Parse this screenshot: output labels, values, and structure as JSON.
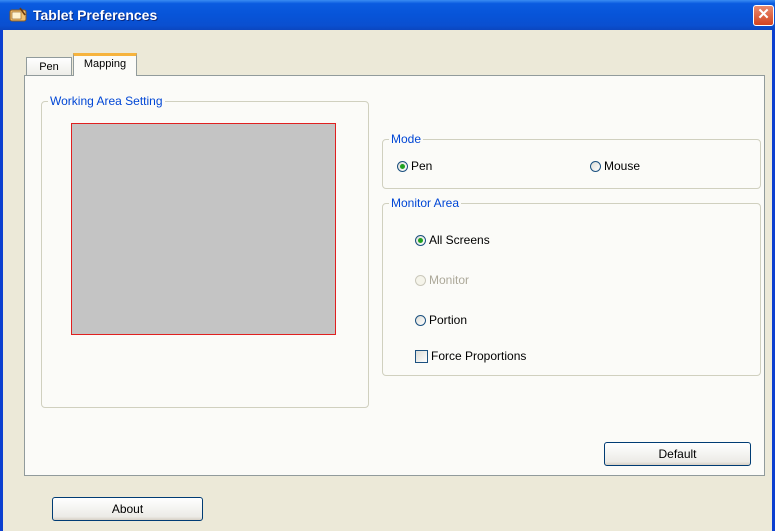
{
  "window": {
    "title": "Tablet Preferences",
    "close_glyph": "✕"
  },
  "tabs": [
    {
      "label": "Pen"
    },
    {
      "label": "Mapping"
    }
  ],
  "working_area": {
    "label": "Working Area Setting"
  },
  "mode": {
    "label": "Mode",
    "options": [
      {
        "label": "Pen",
        "checked": true
      },
      {
        "label": "Mouse",
        "checked": false
      }
    ]
  },
  "monitor_area": {
    "label": "Monitor Area",
    "options": [
      {
        "label": "All Screens",
        "checked": true,
        "enabled": true
      },
      {
        "label": "Monitor",
        "checked": false,
        "enabled": false
      },
      {
        "label": "Portion",
        "checked": false,
        "enabled": true
      }
    ],
    "force_proportions": {
      "label": "Force Proportions",
      "checked": false
    }
  },
  "buttons": {
    "default": "Default",
    "about": "About"
  },
  "colors": {
    "title_bar": "#0754d8",
    "group_label": "#0046d5",
    "work_area_fill": "#c4c4c4",
    "work_area_border": "#e02020",
    "active_tab_accent": "#f6b33d"
  }
}
